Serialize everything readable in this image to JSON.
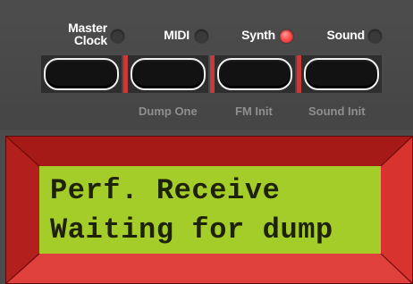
{
  "buttons": [
    {
      "label": "Master\nClock",
      "led_on": false,
      "sub_label": ""
    },
    {
      "label": "MIDI",
      "led_on": false,
      "sub_label": "Dump One"
    },
    {
      "label": "Synth",
      "led_on": true,
      "sub_label": "FM Init"
    },
    {
      "label": "Sound",
      "led_on": false,
      "sub_label": "Sound Init"
    }
  ],
  "labels": {
    "master_line1": "Master",
    "master_line2": "Clock",
    "midi": "MIDI",
    "synth": "Synth",
    "sound": "Sound",
    "dump_one": "Dump One",
    "fm_init": "FM Init",
    "sound_init": "Sound Init"
  },
  "display": {
    "line1": "Perf. Receive",
    "line2": "Waiting for dump"
  },
  "colors": {
    "panel": "#4b4b4b",
    "led_on": "#ff5050",
    "led_off": "#3a3a3a",
    "bezel": "#c2221f",
    "lcd_background": "#a5cd2a",
    "lcd_text": "#1e2207"
  }
}
